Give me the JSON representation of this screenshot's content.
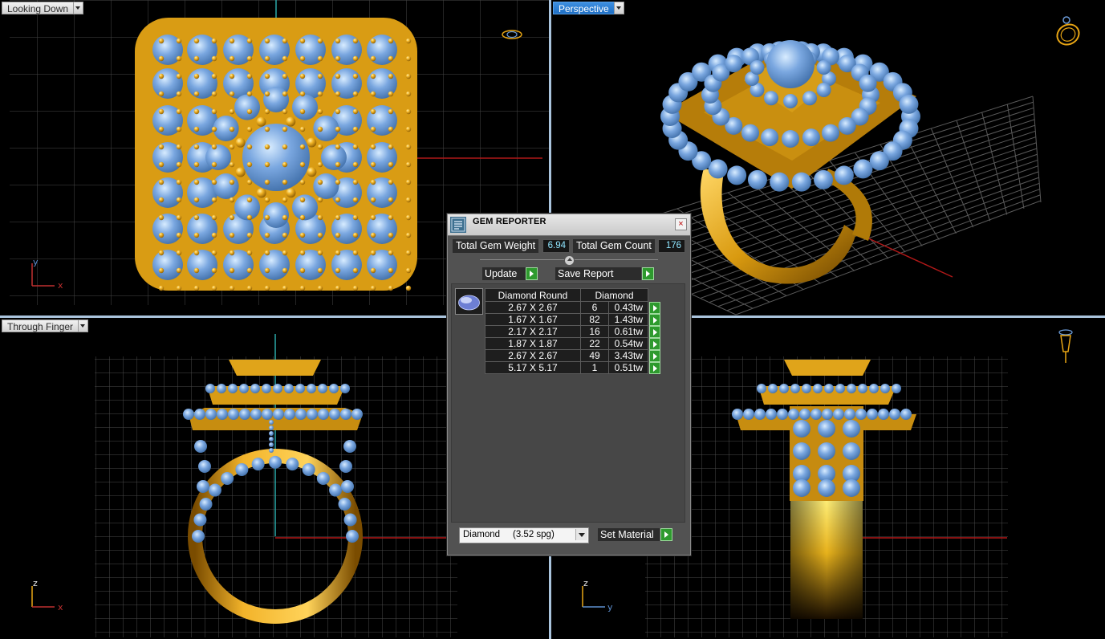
{
  "viewports": {
    "top_left": {
      "label": "Looking Down"
    },
    "top_right": {
      "label": "Perspective"
    },
    "bottom_left": {
      "label": "Through Finger"
    },
    "bottom_right": {
      "label": ""
    }
  },
  "axes": {
    "top_left": {
      "a": "y",
      "b": "x"
    },
    "bottom_left": {
      "a": "z",
      "b": "x"
    },
    "bottom_right": {
      "a": "z",
      "b": "y"
    }
  },
  "gem_reporter": {
    "title": "GEM REPORTER",
    "close": "×",
    "total_weight_label": "Total Gem Weight",
    "total_weight_value": "6.94",
    "total_count_label": "Total Gem Count",
    "total_count_value": "176",
    "update_label": "Update",
    "save_report_label": "Save Report",
    "columns": {
      "shape": "Diamond Round",
      "material": "Diamond"
    },
    "rows": [
      {
        "size": "2.67 X 2.67",
        "count": "6",
        "weight": "0.43tw"
      },
      {
        "size": "1.67 X 1.67",
        "count": "82",
        "weight": "1.43tw"
      },
      {
        "size": "2.17 X 2.17",
        "count": "16",
        "weight": "0.61tw"
      },
      {
        "size": "1.87 X 1.87",
        "count": "22",
        "weight": "0.54tw"
      },
      {
        "size": "2.67 X 2.67",
        "count": "49",
        "weight": "3.43tw"
      },
      {
        "size": "5.17 X 5.17",
        "count": "1",
        "weight": "0.51tw"
      }
    ],
    "material_select": "Diamond     (3.52 spg)",
    "set_material_label": "Set Material"
  },
  "colors": {
    "gold": "#e8a514",
    "gem": "#7aa7e0",
    "grid": "#4a4a4a",
    "active_tab": "#2a7fd4"
  }
}
